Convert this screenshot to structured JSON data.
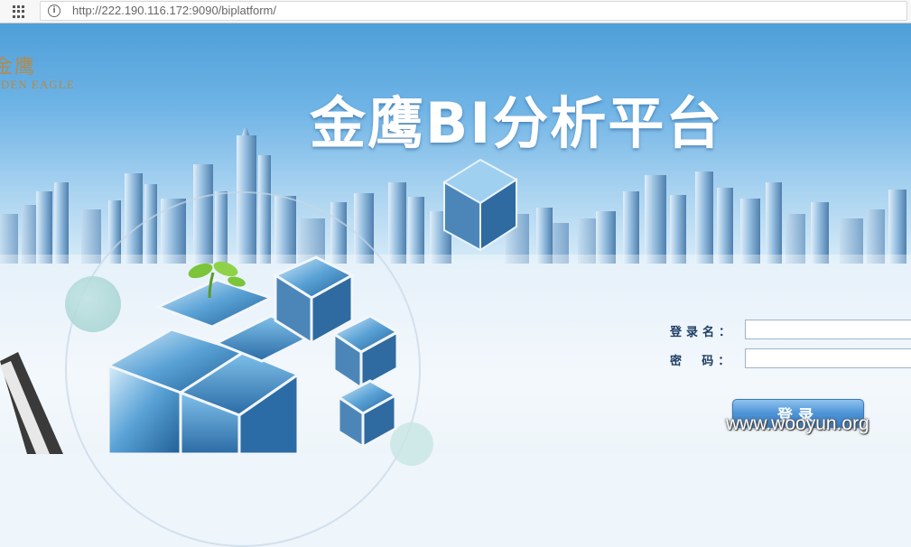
{
  "browser": {
    "url": "http://222.190.116.172:9090/biplatform/"
  },
  "logo": {
    "cn": "金鹰",
    "en": "LDEN EAGLE"
  },
  "header": {
    "title": "金鹰BI分析平台"
  },
  "login": {
    "username_label": "登录名：",
    "username_value": "",
    "password_label": "密  码：",
    "password_value": "",
    "submit_label": "登录"
  },
  "watermark": "www.wooyun.org",
  "colors": {
    "banner_top": "#4e9fd8",
    "button": "#4d93d6",
    "label": "#1e3d63"
  }
}
